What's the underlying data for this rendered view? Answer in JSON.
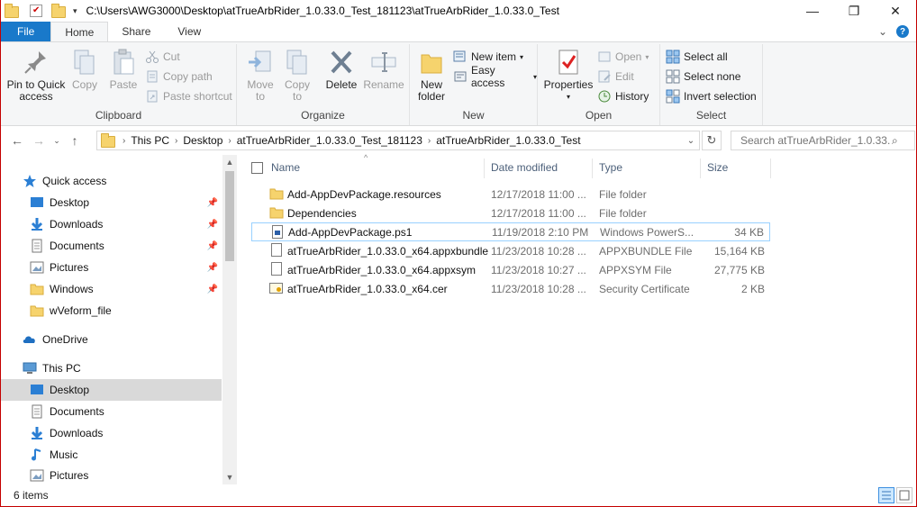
{
  "window": {
    "title_path": "C:\\Users\\AWG3000\\Desktop\\atTrueArbRider_1.0.33.0_Test_181123\\atTrueArbRider_1.0.33.0_Test",
    "controls": {
      "minimize": "—",
      "maximize": "❐",
      "close": "✕"
    }
  },
  "tabs": [
    {
      "label": "File"
    },
    {
      "label": "Home"
    },
    {
      "label": "Share"
    },
    {
      "label": "View"
    }
  ],
  "tabs_right": {
    "expand": "⌄",
    "help": "?"
  },
  "ribbon": {
    "clipboard": {
      "label": "Clipboard",
      "pin": "Pin to Quick access",
      "pin_l1": "Pin to Quick",
      "pin_l2": "access",
      "copy": "Copy",
      "paste": "Paste",
      "cut": "Cut",
      "copy_path": "Copy path",
      "paste_shortcut": "Paste shortcut"
    },
    "organize": {
      "label": "Organize",
      "move_l1": "Move",
      "move_l2": "to",
      "copy_l1": "Copy",
      "copy_l2": "to",
      "delete": "Delete",
      "rename": "Rename"
    },
    "new": {
      "label": "New",
      "new_folder_l1": "New",
      "new_folder_l2": "folder",
      "new_item": "New item",
      "easy_access": "Easy access"
    },
    "open": {
      "label": "Open",
      "properties": "Properties",
      "open": "Open",
      "edit": "Edit",
      "history": "History"
    },
    "select": {
      "label": "Select",
      "select_all": "Select all",
      "select_none": "Select none",
      "invert": "Invert selection"
    }
  },
  "address": {
    "crumbs": [
      "This PC",
      "Desktop",
      "atTrueArbRider_1.0.33.0_Test_181123",
      "atTrueArbRider_1.0.33.0_Test"
    ],
    "search_placeholder": "Search atTrueArbRider_1.0.33...."
  },
  "navpane": {
    "quick_access": "Quick access",
    "quick_items": [
      "Desktop",
      "Downloads",
      "Documents",
      "Pictures",
      "Windows",
      "wVeform_file"
    ],
    "onedrive": "OneDrive",
    "this_pc": "This PC",
    "pc_items": [
      "Desktop",
      "Documents",
      "Downloads",
      "Music",
      "Pictures"
    ]
  },
  "columns": {
    "name": "Name",
    "date": "Date modified",
    "type": "Type",
    "size": "Size"
  },
  "files": [
    {
      "name": "Add-AppDevPackage.resources",
      "date": "12/17/2018 11:00 ...",
      "type": "File folder",
      "size": ""
    },
    {
      "name": "Dependencies",
      "date": "12/17/2018 11:00 ...",
      "type": "File folder",
      "size": ""
    },
    {
      "name": "Add-AppDevPackage.ps1",
      "date": "11/19/2018 2:10 PM",
      "type": "Windows PowerS...",
      "size": "34 KB"
    },
    {
      "name": "atTrueArbRider_1.0.33.0_x64.appxbundle",
      "date": "11/23/2018 10:28 ...",
      "type": "APPXBUNDLE File",
      "size": "15,164 KB"
    },
    {
      "name": "atTrueArbRider_1.0.33.0_x64.appxsym",
      "date": "11/23/2018 10:27 ...",
      "type": "APPXSYM File",
      "size": "27,775 KB"
    },
    {
      "name": "atTrueArbRider_1.0.33.0_x64.cer",
      "date": "11/23/2018 10:28 ...",
      "type": "Security Certificate",
      "size": "2 KB"
    }
  ],
  "status": {
    "count": "6 items"
  },
  "colors": {
    "accent": "#1979ca",
    "folder": "#f6d36d",
    "selected": "#d9d9d9",
    "hover_border": "#99d1ff"
  }
}
